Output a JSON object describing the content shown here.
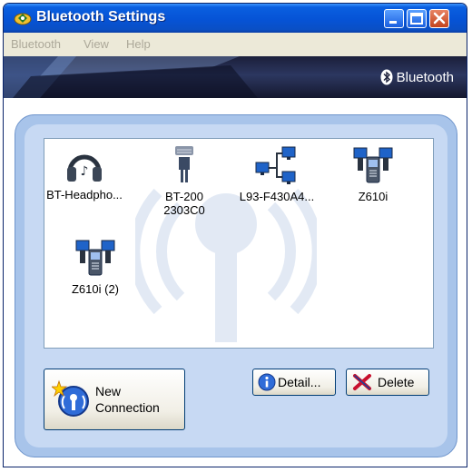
{
  "window": {
    "title": "Bluetooth Settings"
  },
  "menu": {
    "items": [
      {
        "label": "Bluetooth"
      },
      {
        "label": "View"
      },
      {
        "label": "Help"
      }
    ]
  },
  "banner": {
    "brand": "Bluetooth"
  },
  "devices": [
    {
      "label": "BT-Headpho...",
      "icon": "headphones-icon"
    },
    {
      "label": "BT-200\n2303C0",
      "icon": "gps-receiver-icon"
    },
    {
      "label": "L93-F430A4...",
      "icon": "network-computers-icon"
    },
    {
      "label": "Z610i",
      "icon": "phone-sync-icon"
    },
    {
      "label": "Z610i (2)",
      "icon": "phone-sync-icon"
    }
  ],
  "buttons": {
    "new_connection": "New\nConnection",
    "details": "Detail...",
    "delete": "Delete"
  },
  "colors": {
    "titlebar": "#0653d6",
    "frame": "#a8c4ea",
    "panel_border": "#7f9db9"
  }
}
